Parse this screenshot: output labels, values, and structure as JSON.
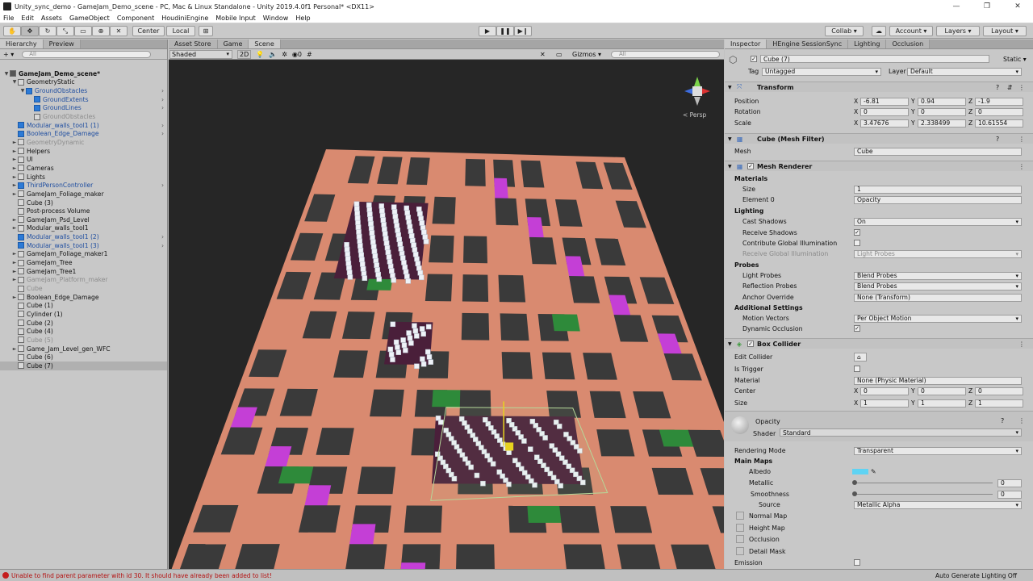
{
  "window": {
    "title": "Unity_sync_demo - GameJam_Demo_scene - PC, Mac & Linux Standalone - Unity 2019.4.0f1 Personal* <DX11>",
    "controls": [
      "—",
      "❐",
      "✕"
    ]
  },
  "menu": [
    "File",
    "Edit",
    "Assets",
    "GameObject",
    "Component",
    "HoudiniEngine",
    "Mobile Input",
    "Window",
    "Help"
  ],
  "toolbar": {
    "center": "Center",
    "local": "Local",
    "collab": "Collab ▾",
    "account": "Account ▾",
    "layers": "Layers ▾",
    "layout": "Layout ▾"
  },
  "hierarchy": {
    "tabs": [
      "Hierarchy",
      "Preview"
    ],
    "add": "+ ▾",
    "search_placeholder": "All",
    "items": [
      {
        "label": "GameJam_Demo_scene*",
        "indent": 0,
        "style": "scene",
        "arrow": "▼"
      },
      {
        "label": "GeometryStatic",
        "indent": 1,
        "style": "",
        "arrow": "▼"
      },
      {
        "label": "GroundObstacles",
        "indent": 2,
        "style": "blue",
        "arrow": "▼"
      },
      {
        "label": "GroundExtents",
        "indent": 3,
        "style": "blue",
        "arrow": ""
      },
      {
        "label": "GroundLines",
        "indent": 3,
        "style": "blue",
        "arrow": ""
      },
      {
        "label": "GroundObstacles",
        "indent": 3,
        "style": "gray",
        "arrow": ""
      },
      {
        "label": "Modular_walls_tool1 (1)",
        "indent": 1,
        "style": "blue",
        "arrow": ""
      },
      {
        "label": "Boolean_Edge_Damage",
        "indent": 1,
        "style": "blue",
        "arrow": ""
      },
      {
        "label": "GeometryDynamic",
        "indent": 1,
        "style": "gray",
        "arrow": "►"
      },
      {
        "label": "Helpers",
        "indent": 1,
        "style": "",
        "arrow": "►"
      },
      {
        "label": "UI",
        "indent": 1,
        "style": "",
        "arrow": "►"
      },
      {
        "label": "Cameras",
        "indent": 1,
        "style": "",
        "arrow": "►"
      },
      {
        "label": "Lights",
        "indent": 1,
        "style": "",
        "arrow": "►"
      },
      {
        "label": "ThirdPersonController",
        "indent": 1,
        "style": "blue",
        "arrow": "►"
      },
      {
        "label": "GameJam_Foliage_maker",
        "indent": 1,
        "style": "",
        "arrow": "►"
      },
      {
        "label": "Cube (3)",
        "indent": 1,
        "style": "",
        "arrow": ""
      },
      {
        "label": "Post-process Volume",
        "indent": 1,
        "style": "",
        "arrow": ""
      },
      {
        "label": "GameJam_Psd_Level",
        "indent": 1,
        "style": "",
        "arrow": "►"
      },
      {
        "label": "Modular_walls_tool1",
        "indent": 1,
        "style": "",
        "arrow": "►"
      },
      {
        "label": "Modular_walls_tool1 (2)",
        "indent": 1,
        "style": "blue",
        "arrow": ""
      },
      {
        "label": "Modular_walls_tool1 (3)",
        "indent": 1,
        "style": "blue",
        "arrow": ""
      },
      {
        "label": "GameJam_Foliage_maker1",
        "indent": 1,
        "style": "",
        "arrow": "►"
      },
      {
        "label": "GameJam_Tree",
        "indent": 1,
        "style": "",
        "arrow": "►"
      },
      {
        "label": "GameJam_Tree1",
        "indent": 1,
        "style": "",
        "arrow": "►"
      },
      {
        "label": "GameJam_Platform_maker",
        "indent": 1,
        "style": "gray",
        "arrow": "►"
      },
      {
        "label": "Cube",
        "indent": 1,
        "style": "gray",
        "arrow": ""
      },
      {
        "label": "Boolean_Edge_Damage",
        "indent": 1,
        "style": "",
        "arrow": "►"
      },
      {
        "label": "Cube (1)",
        "indent": 1,
        "style": "",
        "arrow": ""
      },
      {
        "label": "Cylinder (1)",
        "indent": 1,
        "style": "",
        "arrow": ""
      },
      {
        "label": "Cube (2)",
        "indent": 1,
        "style": "",
        "arrow": ""
      },
      {
        "label": "Cube (4)",
        "indent": 1,
        "style": "",
        "arrow": ""
      },
      {
        "label": "Cube (5)",
        "indent": 1,
        "style": "gray",
        "arrow": ""
      },
      {
        "label": "Game_Jam_Level_gen_WFC",
        "indent": 1,
        "style": "",
        "arrow": "►"
      },
      {
        "label": "Cube (6)",
        "indent": 1,
        "style": "",
        "arrow": ""
      },
      {
        "label": "Cube (7)",
        "indent": 1,
        "style": "sel",
        "arrow": ""
      }
    ]
  },
  "scene": {
    "tabs": [
      "Asset Store",
      "Game",
      "Scene"
    ],
    "shading": "Shaded",
    "mode2d": "2D",
    "fx_count": "0",
    "gizmos": "Gizmos ▾",
    "search_placeholder": "All",
    "persp": "< Persp"
  },
  "inspector": {
    "tabs": [
      "Inspector",
      "HEngine SessionSync",
      "Lighting",
      "Occlusion"
    ],
    "object_name": "Cube (7)",
    "static": "Static ▾",
    "tag_label": "Tag",
    "tag": "Untagged",
    "layer_label": "Layer",
    "layer": "Default",
    "transform": {
      "title": "Transform",
      "position_label": "Position",
      "position": [
        "-6.81",
        "0.94",
        "-1.9"
      ],
      "rotation_label": "Rotation",
      "rotation": [
        "0",
        "0",
        "0"
      ],
      "scale_label": "Scale",
      "scale": [
        "3.47676",
        "2.338499",
        "10.61554"
      ]
    },
    "axes": [
      "X",
      "Y",
      "Z"
    ],
    "mesh_filter": {
      "title": "Cube (Mesh Filter)",
      "mesh_label": "Mesh",
      "mesh": "Cube"
    },
    "mesh_renderer": {
      "title": "Mesh Renderer",
      "materials": "Materials",
      "size_label": "Size",
      "size": "1",
      "element_label": "Element 0",
      "element": "Opacity",
      "lighting": "Lighting",
      "cast_label": "Cast Shadows",
      "cast": "On",
      "receive_label": "Receive Shadows",
      "contrib_label": "Contribute Global Illumination",
      "rgi_label": "Receive Global Illumination",
      "rgi": "Light Probes",
      "probes": "Probes",
      "lp_label": "Light Probes",
      "lp": "Blend Probes",
      "rp_label": "Reflection Probes",
      "rp": "Blend Probes",
      "anchor_label": "Anchor Override",
      "anchor": "None (Transform)",
      "additional": "Additional Settings",
      "mv_label": "Motion Vectors",
      "mv": "Per Object Motion",
      "doc_label": "Dynamic Occlusion"
    },
    "box_collider": {
      "title": "Box Collider",
      "edit_label": "Edit Collider",
      "trigger_label": "Is Trigger",
      "material_label": "Material",
      "material": "None (Physic Material)",
      "center_label": "Center",
      "center": [
        "0",
        "0",
        "0"
      ],
      "size_label": "Size",
      "size": [
        "1",
        "1",
        "1"
      ]
    },
    "material": {
      "name": "Opacity",
      "shader_label": "Shader",
      "shader": "Standard",
      "render_label": "Rendering Mode",
      "render": "Transparent",
      "main_maps": "Main Maps",
      "albedo": "Albedo",
      "metallic": "Metallic",
      "metallic_val": "0",
      "smooth": "Smoothness",
      "smooth_val": "0",
      "source_label": "Source",
      "source": "Metallic Alpha",
      "normal": "Normal Map",
      "height": "Height Map",
      "occlusion": "Occlusion",
      "detail": "Detail Mask",
      "emission": "Emission",
      "albedo_color": "#5fd3f3"
    }
  },
  "status": {
    "message": "Unable to find parent parameter with id 30. It should have already been added to list!",
    "right": "Auto Generate Lighting Off"
  },
  "colors": {
    "salmon": "#d98a70",
    "magenta": "#c43fd6",
    "dark": "#3a3a3a",
    "green": "#2e8a3a",
    "lime": "#9bd80a"
  }
}
